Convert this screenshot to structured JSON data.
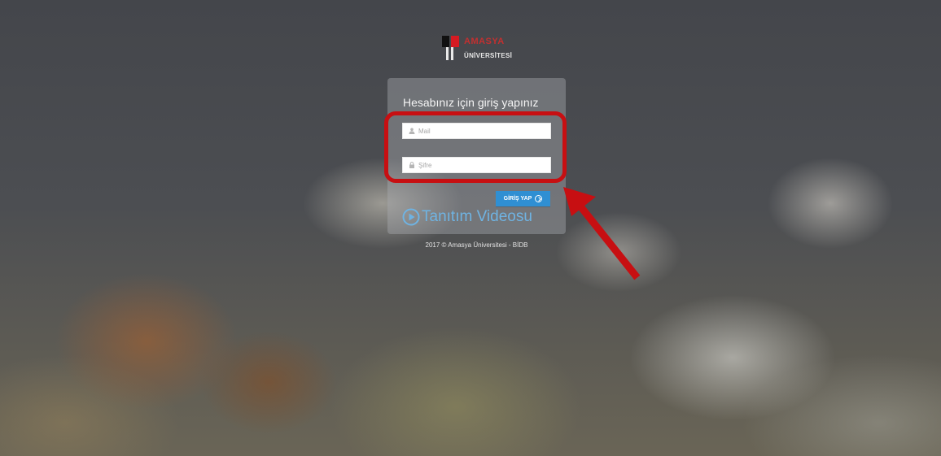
{
  "logo": {
    "title_text": "AMASYA",
    "subtitle_text": "ÜNİVERSİTESİ"
  },
  "login": {
    "heading": "Hesabınız için giriş yapınız",
    "email_placeholder": "Mail",
    "password_placeholder": "Şifre",
    "submit_label": "GİRİŞ YAP",
    "video_link_label": "Tanıtım Videosu"
  },
  "footer": {
    "copyright": "2017 © Amasya Üniversitesi - BİDB"
  },
  "annotations": {
    "highlight_color": "#c70f12",
    "arrow_color": "#c70f12"
  },
  "colors": {
    "button_bg": "#2f8fd3",
    "link_color": "#6fb3e2"
  },
  "icons": {
    "email_field": "user-icon",
    "password_field": "lock-icon",
    "submit_button": "circle-arrow-right-icon",
    "video_link": "play-circle-icon"
  }
}
